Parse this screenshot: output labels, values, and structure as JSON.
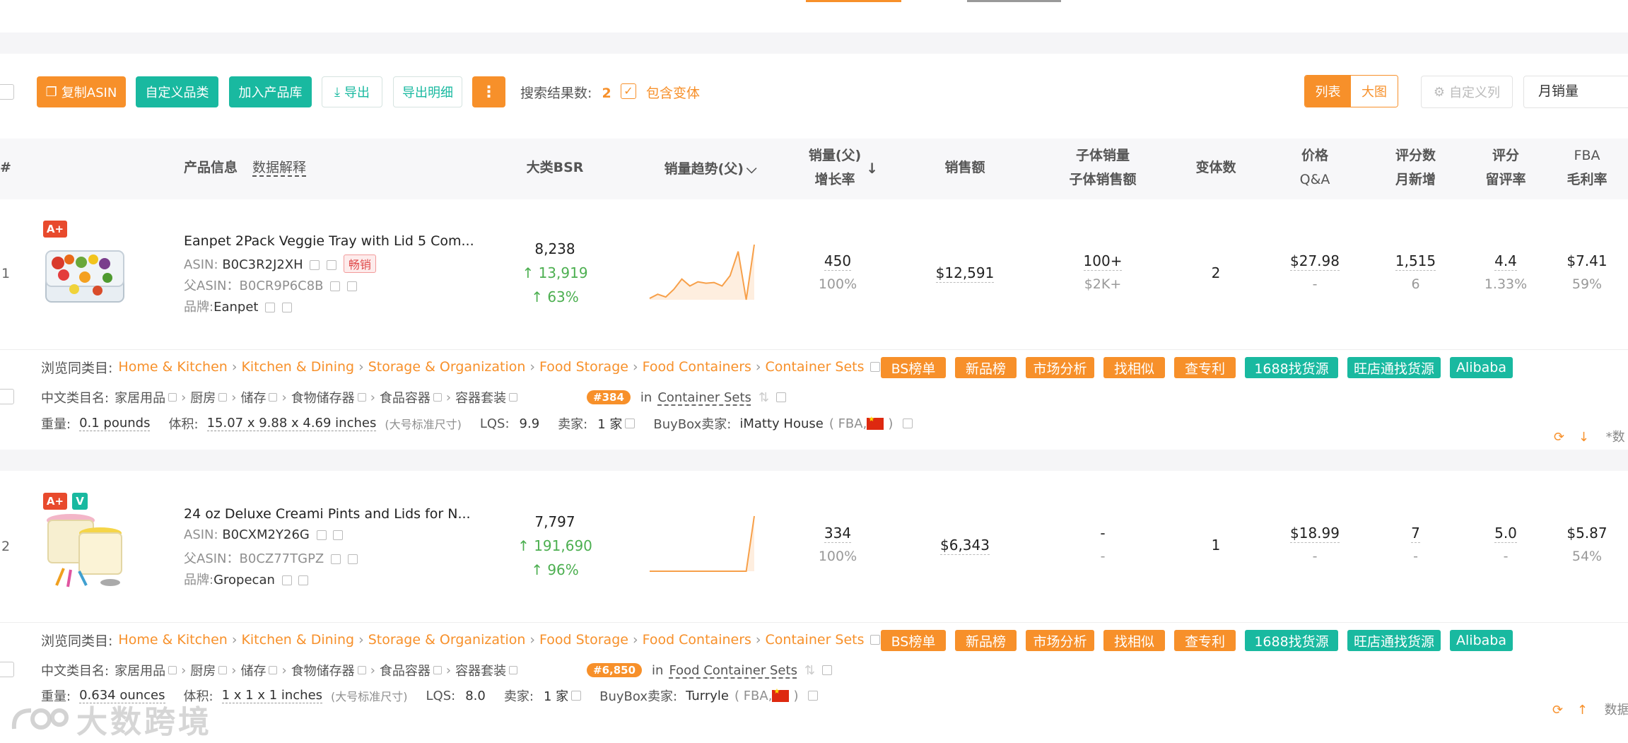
{
  "toolbar": {
    "copy_asin": "复制ASIN",
    "custom_category": "自定义品类",
    "add_to_library": "加入产品库",
    "export": "导出",
    "export_detail": "导出明细",
    "more": "⋮",
    "result_count_label": "搜索结果数:",
    "result_count": "2",
    "include_variants": "包含变体",
    "view_list": "列表",
    "view_grid": "大图",
    "custom_columns": "自定义列",
    "sort_select": "月销量"
  },
  "table_header": {
    "index": "#",
    "product_info": "产品信息",
    "data_explain": "数据解释",
    "bsr": "大类BSR",
    "sales_trend": "销量趋势(父)",
    "sales_parent": "销量(父)",
    "growth_rate": "增长率",
    "revenue": "销售额",
    "child_sales": "子体销量",
    "child_revenue": "子体销售额",
    "variants": "变体数",
    "price": "价格",
    "qa": "Q&A",
    "ratings": "评分数",
    "monthly_new": "月新增",
    "rating": "评分",
    "review_rate": "留评率",
    "fba": "FBA",
    "margin": "毛利率"
  },
  "rows": [
    {
      "index": "1",
      "badges": [
        "A+"
      ],
      "title": "Eanpet 2Pack Veggie Tray with Lid 5 Com...",
      "asin_label": "ASIN:",
      "asin": "B0C3R2J2XH",
      "tag": "畅销",
      "parent_label": "父ASIN：",
      "parent_asin": "B0CR9P6C8B",
      "brand_label": "品牌:",
      "brand": "Eanpet",
      "bsr": "8,238",
      "bsr_change": "13,919",
      "bsr_pct": "63%",
      "sales": "450",
      "sales_growth": "100%",
      "revenue": "$12,591",
      "child_sales": "100+",
      "child_revenue": "$2K+",
      "variants": "2",
      "price": "$27.98",
      "qa": "-",
      "ratings": "1,515",
      "monthly_new": "6",
      "rating": "4.4",
      "review_rate": "1.33%",
      "fba": "$7.41",
      "margin": "59%",
      "trend": [
        12,
        18,
        14,
        25,
        40,
        30,
        36,
        34,
        35,
        30,
        45,
        80,
        10,
        90
      ],
      "browse_label": "浏览同类目:",
      "categories": [
        "Home & Kitchen",
        "Kitchen & Dining",
        "Storage & Organization",
        "Food Storage",
        "Food Containers",
        "Container Sets"
      ],
      "cn_label": "中文类目名:",
      "cn_categories": [
        "家居用品",
        "厨房",
        "储存",
        "食物储存器",
        "食品容器",
        "容器套装"
      ],
      "rank": "#384",
      "rank_in": "in",
      "rank_cat": "Container Sets",
      "weight_label": "重量:",
      "weight": "0.1 pounds",
      "volume_label": "体积:",
      "volume": "15.07 x 9.88 x 4.69 inches",
      "size_class": "(大号标准尺寸)",
      "lqs_label": "LQS:",
      "lqs": "9.9",
      "seller_label": "卖家:",
      "sellers": "1 家",
      "buybox_label": "BuyBox卖家:",
      "buybox": "iMatty House",
      "buybox_fba_open": "( FBA,",
      "buybox_fba_close": ")"
    },
    {
      "index": "2",
      "badges": [
        "A+",
        "V"
      ],
      "title": "24 oz Deluxe Creami Pints and Lids for N...",
      "asin_label": "ASIN:",
      "asin": "B0CXM2Y26G",
      "tag": "",
      "parent_label": "父ASIN：",
      "parent_asin": "B0CZ77TGPZ",
      "brand_label": "品牌:",
      "brand": "Gropecan",
      "bsr": "7,797",
      "bsr_change": "191,690",
      "bsr_pct": "96%",
      "sales": "334",
      "sales_growth": "100%",
      "revenue": "$6,343",
      "child_sales": "-",
      "child_revenue": "-",
      "variants": "1",
      "price": "$18.99",
      "qa": "-",
      "ratings": "7",
      "monthly_new": "-",
      "rating": "5.0",
      "review_rate": "-",
      "fba": "$5.87",
      "margin": "54%",
      "trend": [
        0,
        0,
        0,
        0,
        0,
        0,
        0,
        0,
        0,
        0,
        0,
        0,
        0,
        100
      ],
      "browse_label": "浏览同类目:",
      "categories": [
        "Home & Kitchen",
        "Kitchen & Dining",
        "Storage & Organization",
        "Food Storage",
        "Food Containers",
        "Container Sets"
      ],
      "cn_label": "中文类目名:",
      "cn_categories": [
        "家居用品",
        "厨房",
        "储存",
        "食物储存器",
        "食品容器",
        "容器套装"
      ],
      "rank": "#6,850",
      "rank_in": "in",
      "rank_cat": "Food Container Sets",
      "weight_label": "重量:",
      "weight": "0.634 ounces",
      "volume_label": "体积:",
      "volume": "1 x 1 x 1 inches",
      "size_class": "(大号标准尺寸)",
      "lqs_label": "LQS:",
      "lqs": "8.0",
      "seller_label": "卖家:",
      "sellers": "1 家",
      "buybox_label": "BuyBox卖家:",
      "buybox": "Turryle",
      "buybox_fba_open": "( FBA,",
      "buybox_fba_close": ")"
    }
  ],
  "action_chips": [
    "BS榜单",
    "新品榜",
    "市场分析",
    "找相似",
    "查专利",
    "1688找货源",
    "旺店通找货源",
    "Alibaba"
  ],
  "row_tail_1": "*数",
  "row_tail_2": "数据",
  "watermark": "大数跨境",
  "colors": {
    "accent": "#f7902a",
    "teal": "#19b9a0",
    "green": "#4caf50",
    "badge_red": "#e84a2d"
  }
}
